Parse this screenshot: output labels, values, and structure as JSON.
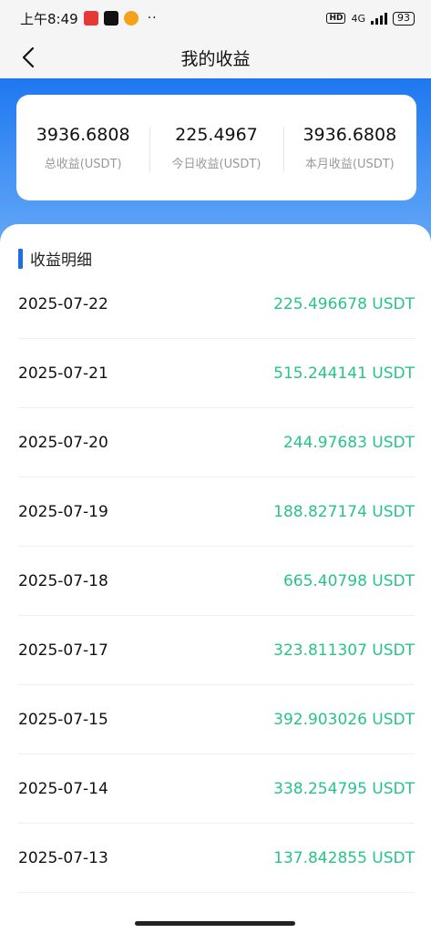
{
  "status_bar": {
    "time": "上午8:49",
    "network": "4G",
    "hd": "HD",
    "battery": "93",
    "dots": "··"
  },
  "header": {
    "title": "我的收益"
  },
  "summary": [
    {
      "value": "3936.6808",
      "label": "总收益(USDT)"
    },
    {
      "value": "225.4967",
      "label": "今日收益(USDT)"
    },
    {
      "value": "3936.6808",
      "label": "本月收益(USDT)"
    }
  ],
  "details": {
    "title": "收益明细",
    "records": [
      {
        "date": "2025-07-22",
        "amount": "225.496678 USDT"
      },
      {
        "date": "2025-07-21",
        "amount": "515.244141 USDT"
      },
      {
        "date": "2025-07-20",
        "amount": "244.97683 USDT"
      },
      {
        "date": "2025-07-19",
        "amount": "188.827174 USDT"
      },
      {
        "date": "2025-07-18",
        "amount": "665.40798 USDT"
      },
      {
        "date": "2025-07-17",
        "amount": "323.811307 USDT"
      },
      {
        "date": "2025-07-15",
        "amount": "392.903026 USDT"
      },
      {
        "date": "2025-07-14",
        "amount": "338.254795 USDT"
      },
      {
        "date": "2025-07-13",
        "amount": "137.842855 USDT"
      }
    ]
  },
  "colors": {
    "accent": "#1e78f0",
    "amount": "#27c48a"
  }
}
